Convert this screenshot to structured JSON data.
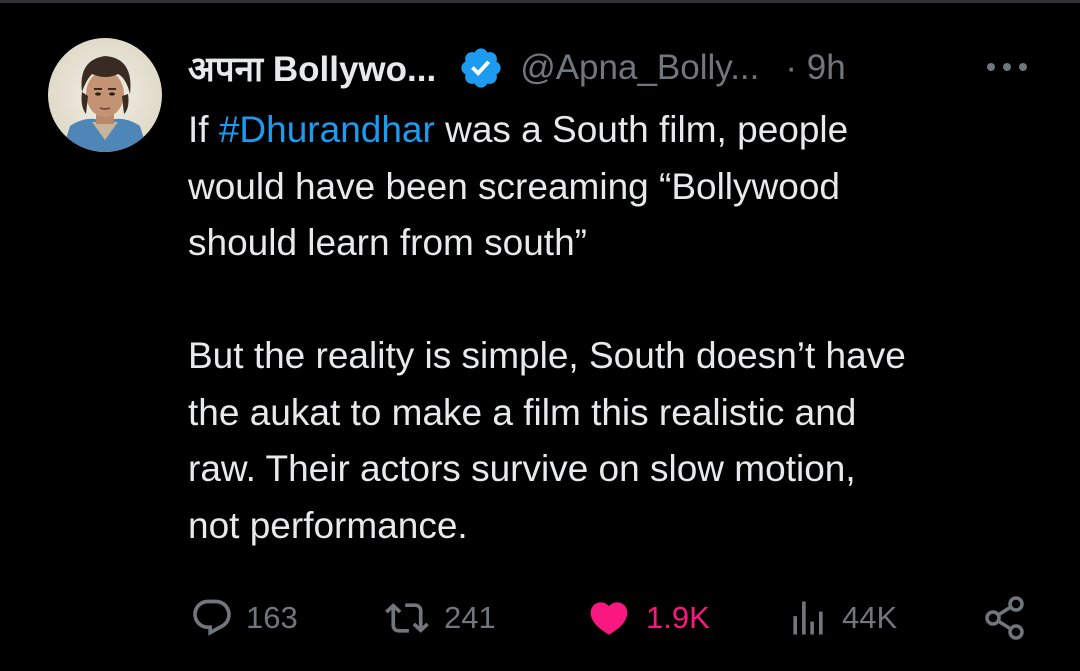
{
  "colors": {
    "background": "#000000",
    "text": "#e7e9ea",
    "secondary": "#71767b",
    "link": "#1d9bf0",
    "verified": "#1d9bf0",
    "like": "#f91880"
  },
  "tweet": {
    "author": {
      "display_name": "अपना Bollywo...",
      "handle": "@Apna_Bolly...",
      "time": "· 9h",
      "verified": true
    },
    "text": {
      "line1_before": "If ",
      "hashtag": "#Dhurandhar",
      "line1_after": " was a South film, people\nwould have been screaming “Bollywood\nshould learn from south”",
      "paragraph2": "But the reality is simple, South doesn’t have\nthe aukat to make a film this realistic and\nraw. Their actors survive on slow motion,\nnot performance."
    },
    "actions": {
      "replies": "163",
      "reposts": "241",
      "likes": "1.9K",
      "views": "44K"
    },
    "icons": {
      "avatar": "avatar-photo",
      "verified": "verified-badge-icon",
      "more": "more-options-icon",
      "reply": "reply-icon",
      "repost": "repost-icon",
      "like": "heart-icon",
      "views": "views-icon",
      "share": "share-icon"
    }
  }
}
